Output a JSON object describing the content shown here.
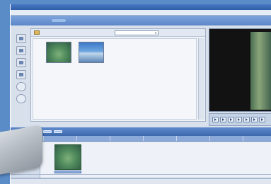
{
  "app": {
    "title": ""
  },
  "menu": {
    "items": [
      "",
      "",
      "",
      "",
      ""
    ]
  },
  "tabs": [
    {
      "label": "",
      "active": false
    },
    {
      "label": "",
      "active": true
    },
    {
      "label": "",
      "active": false
    },
    {
      "label": "",
      "active": false
    }
  ],
  "library": {
    "dropdown_value": "",
    "items": [
      {
        "caption": ""
      },
      {
        "caption": ""
      }
    ]
  },
  "timeline": {
    "buttons": [
      "",
      "",
      "",
      ""
    ],
    "tracks": [
      {
        "label": ""
      },
      {
        "label": ""
      },
      {
        "label": ""
      }
    ]
  },
  "colors": {
    "accent": "#5b86c8",
    "titlebar": "#2f5ea8",
    "panel": "#eef2f7",
    "preview_bg": "#121212"
  },
  "icons": {
    "tools": [
      "capture-icon",
      "edit-icon",
      "effects-icon",
      "film-icon",
      "circle-icon",
      "circle-icon"
    ],
    "controls": [
      "play-icon",
      "rewind-icon",
      "forward-icon",
      "stop-icon",
      "step-back-icon",
      "step-forward-icon",
      "fullscreen-icon"
    ]
  }
}
